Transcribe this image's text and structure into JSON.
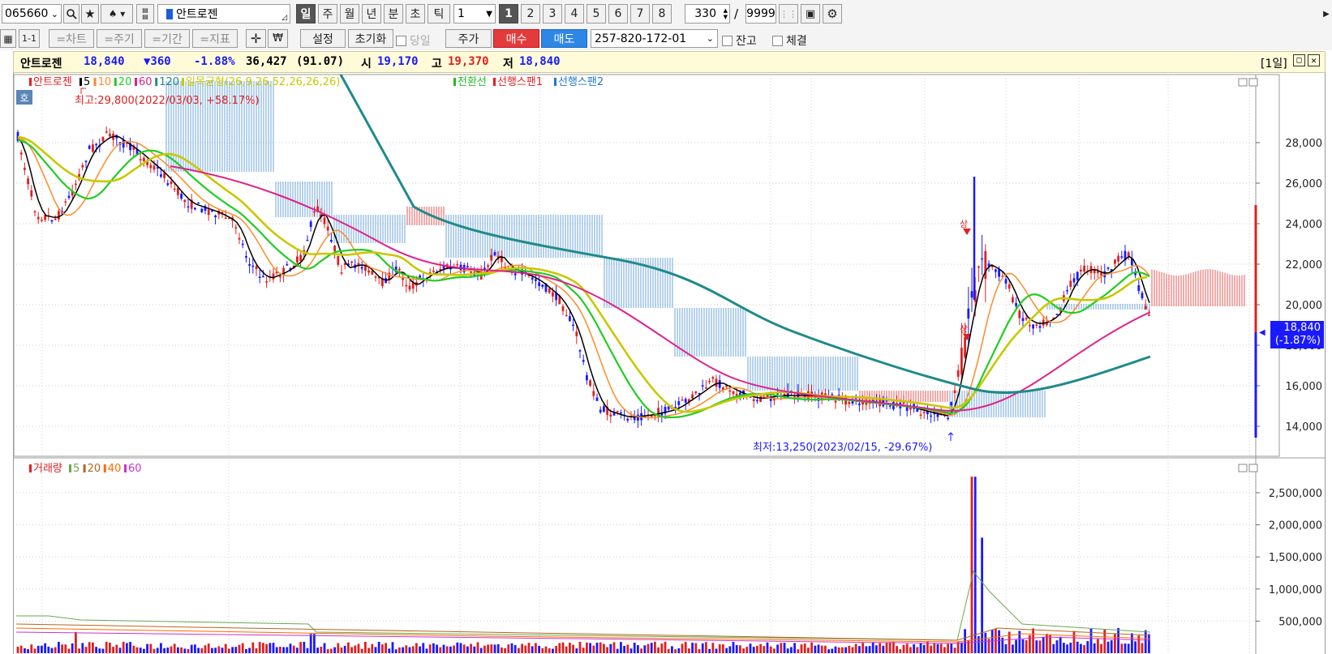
{
  "toolbar": {
    "code": "065660",
    "stock_name": "안트로젠",
    "periods": [
      "일",
      "주",
      "월",
      "년",
      "분",
      "초",
      "틱"
    ],
    "interval_value": "1",
    "page_buttons": [
      "1",
      "2",
      "3",
      "4",
      "5",
      "6",
      "7",
      "8"
    ],
    "count": "330",
    "separator": "/",
    "max_count": "9999"
  },
  "toolbar2": {
    "tabs": [
      "1-1",
      "=차트",
      "=주기",
      "=기간",
      "=지표"
    ],
    "setting_label": "설정",
    "reset_label": "초기화",
    "today_label": "당일",
    "price_label": "주가",
    "buy_label": "매수",
    "sell_label": "매도",
    "account": "257-820-172-01",
    "balance_label": "잔고",
    "fill_label": "체결"
  },
  "infobar": {
    "name": "안트로젠",
    "price": "18,840",
    "change": "▼360",
    "change_pct": "-1.88%",
    "volume": "36,427",
    "turnover": "(91.07)",
    "open_label": "시",
    "open": "19,170",
    "high_label": "고",
    "high": "19,370",
    "low_label": "저",
    "low": "18,840",
    "period": "[1일]"
  },
  "price_panel": {
    "legend": [
      {
        "text": "안트로젠",
        "color": "#e02020"
      },
      {
        "text": "5",
        "color": "#000000"
      },
      {
        "text": "10",
        "color": "#ff8a2a"
      },
      {
        "text": "20",
        "color": "#22cc22"
      },
      {
        "text": "60",
        "color": "#e0208a"
      },
      {
        "text": "120",
        "color": "#1f8a8a"
      },
      {
        "text": "일목균형(26,9,26,52,26,26,26)",
        "color": "#c8c800"
      },
      {
        "text": "전환선",
        "color": "#22bb22"
      },
      {
        "text": "선행스팬1",
        "color": "#e02020"
      },
      {
        "text": "선행스팬2",
        "color": "#1f77cc"
      }
    ],
    "hoga_label": "호",
    "high_note": "최고:29,800(2022/03/03, +58.17%)",
    "low_note": "최저:13,250(2023/02/15, -29.67%)",
    "signal_label": "상",
    "y_ticks": [
      "28,000",
      "26,000",
      "24,000",
      "22,000",
      "20,000",
      "18,000",
      "16,000",
      "14,000"
    ],
    "current_price": "18,840",
    "current_pct": "(-1.87%)"
  },
  "volume_panel": {
    "legend": [
      {
        "text": "거래량",
        "color": "#e02020"
      },
      {
        "text": "5",
        "color": "#6aa84f"
      },
      {
        "text": "20",
        "color": "#b5651d"
      },
      {
        "text": "40",
        "color": "#ff6a00"
      },
      {
        "text": "60",
        "color": "#cc33cc"
      }
    ],
    "y_ticks": [
      "2,500,000",
      "2,000,000",
      "1,500,000",
      "1,000,000",
      "500,000"
    ]
  },
  "colors": {
    "up": "#e02020",
    "down": "#1a1aff",
    "ma5": "#000000",
    "ma10": "#ff8a2a",
    "ma20": "#22cc22",
    "ma60": "#e0208a",
    "ma120": "#1f8a8a",
    "ichimoku": "#c8c800"
  }
}
